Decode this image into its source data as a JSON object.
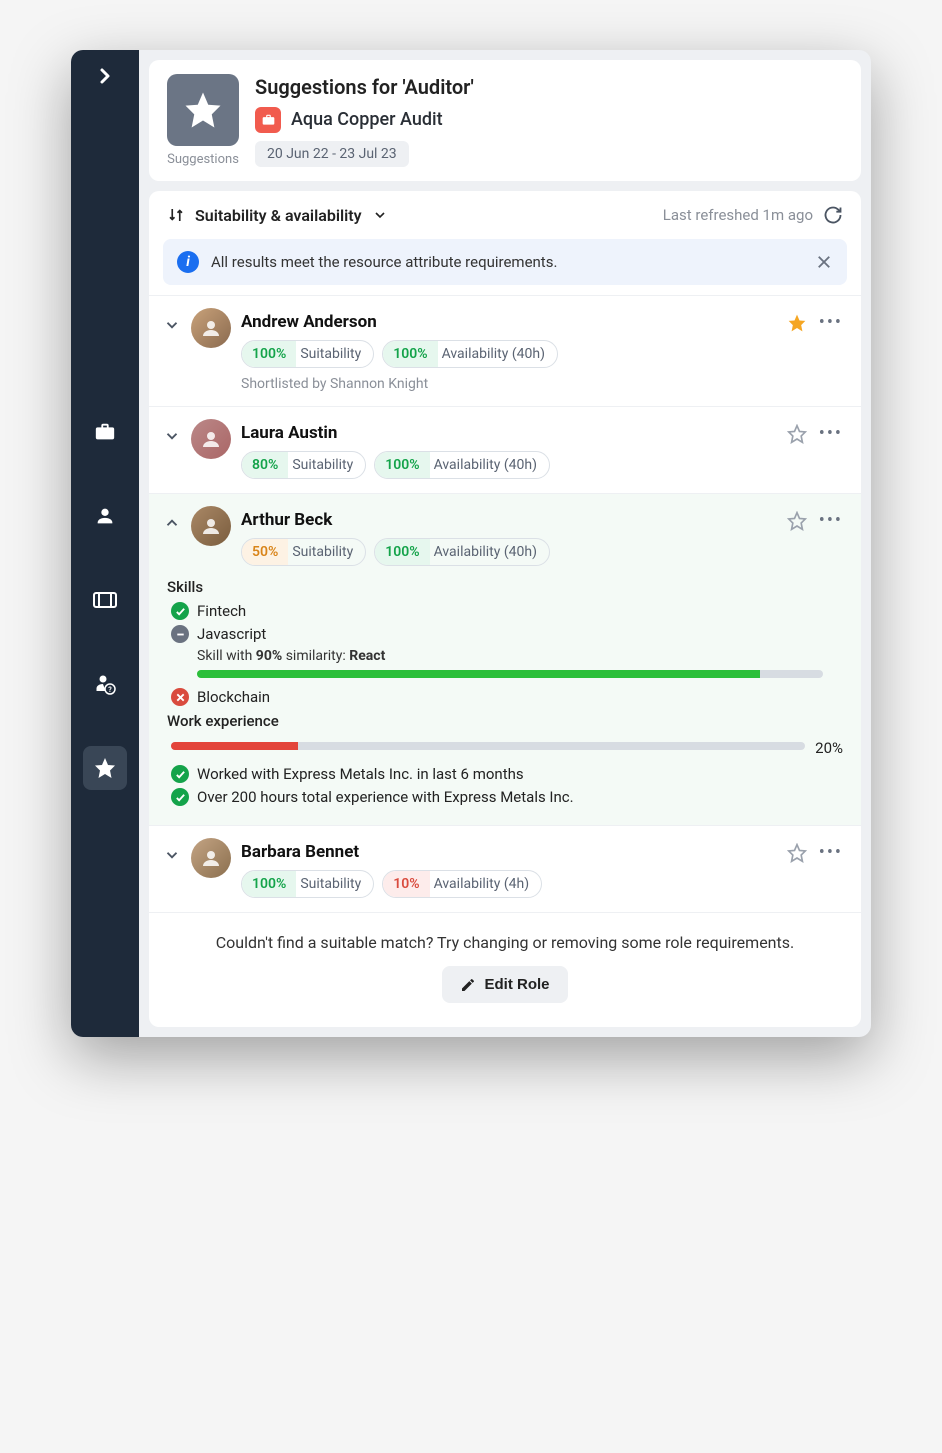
{
  "header": {
    "suggestions_label": "Suggestions",
    "title": "Suggestions for 'Auditor'",
    "project": "Aqua Copper Audit",
    "date_range": "20 Jun 22 - 23 Jul 23"
  },
  "sort": {
    "label": "Suitability & availability",
    "refreshed": "Last refreshed 1m ago"
  },
  "banner": {
    "text": "All results meet the resource attribute requirements."
  },
  "people": [
    {
      "name": "Andrew Anderson",
      "suitability_pct": "100%",
      "suitability_color": "green",
      "availability_pct": "100%",
      "availability_color": "green",
      "availability_label": "Availability (40h)",
      "starred": true,
      "shortlist": "Shortlisted by Shannon Knight"
    },
    {
      "name": "Laura Austin",
      "suitability_pct": "80%",
      "suitability_color": "green",
      "availability_pct": "100%",
      "availability_color": "green",
      "availability_label": "Availability (40h)",
      "starred": false
    },
    {
      "name": "Arthur Beck",
      "suitability_pct": "50%",
      "suitability_color": "orange",
      "availability_pct": "100%",
      "availability_color": "green",
      "availability_label": "Availability (40h)",
      "starred": false,
      "expanded": true
    },
    {
      "name": "Barbara Bennet",
      "suitability_pct": "100%",
      "suitability_color": "green",
      "availability_pct": "10%",
      "availability_color": "red",
      "availability_label": "Availability (4h)",
      "starred": false
    }
  ],
  "suitability_label": "Suitability",
  "details": {
    "skills_label": "Skills",
    "skills": [
      {
        "status": "ok",
        "name": "Fintech"
      },
      {
        "status": "dash",
        "name": "Javascript"
      },
      {
        "status": "bad",
        "name": "Blockchain"
      }
    ],
    "similarity_prefix": "Skill with ",
    "similarity_pct": "90%",
    "similarity_mid": " similarity: ",
    "similarity_skill": "React",
    "similarity_bar_pct": 90,
    "work_label": "Work experience",
    "work_pct_label": "20%",
    "work_bar_pct": 20,
    "work_items": [
      "Worked with Express Metals Inc. in last 6 months",
      "Over 200 hours total experience with Express Metals Inc."
    ]
  },
  "footer": {
    "text": "Couldn't find a suitable match? Try changing or removing some role requirements.",
    "button": "Edit Role"
  }
}
